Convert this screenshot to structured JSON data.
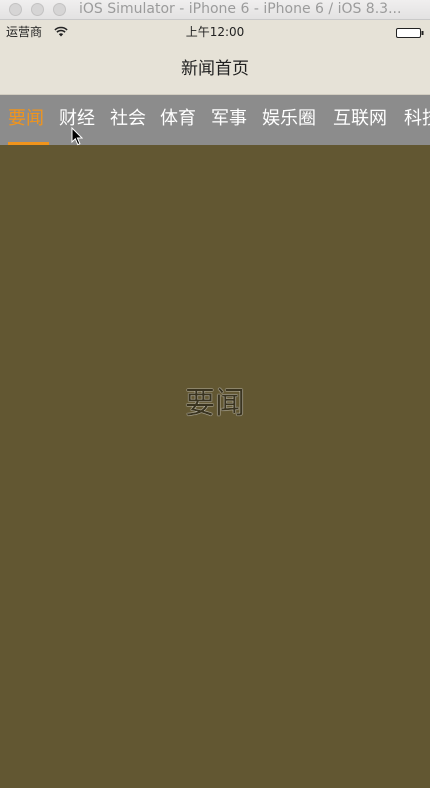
{
  "window": {
    "title": "iOS Simulator - iPhone 6 - iPhone 6 / iOS 8.3..."
  },
  "status_bar": {
    "carrier": "运营商",
    "time": "上午12:00",
    "wifi_icon": "wifi-icon",
    "battery_icon": "battery-icon"
  },
  "nav_bar": {
    "title": "新闻首页"
  },
  "tabs": [
    {
      "label": "要闻",
      "active": true
    },
    {
      "label": "财经",
      "active": false
    },
    {
      "label": "社会",
      "active": false
    },
    {
      "label": "体育",
      "active": false
    },
    {
      "label": "军事",
      "active": false
    },
    {
      "label": "娱乐圈",
      "active": false
    },
    {
      "label": "互联网",
      "active": false
    },
    {
      "label": "科技",
      "active": false
    }
  ],
  "content": {
    "label": "要闻"
  },
  "colors": {
    "accent": "#f0941c",
    "tab_bar_bg": "#8c8c8c",
    "content_bg": "#625732",
    "nav_bg": "#e6e2d7"
  }
}
